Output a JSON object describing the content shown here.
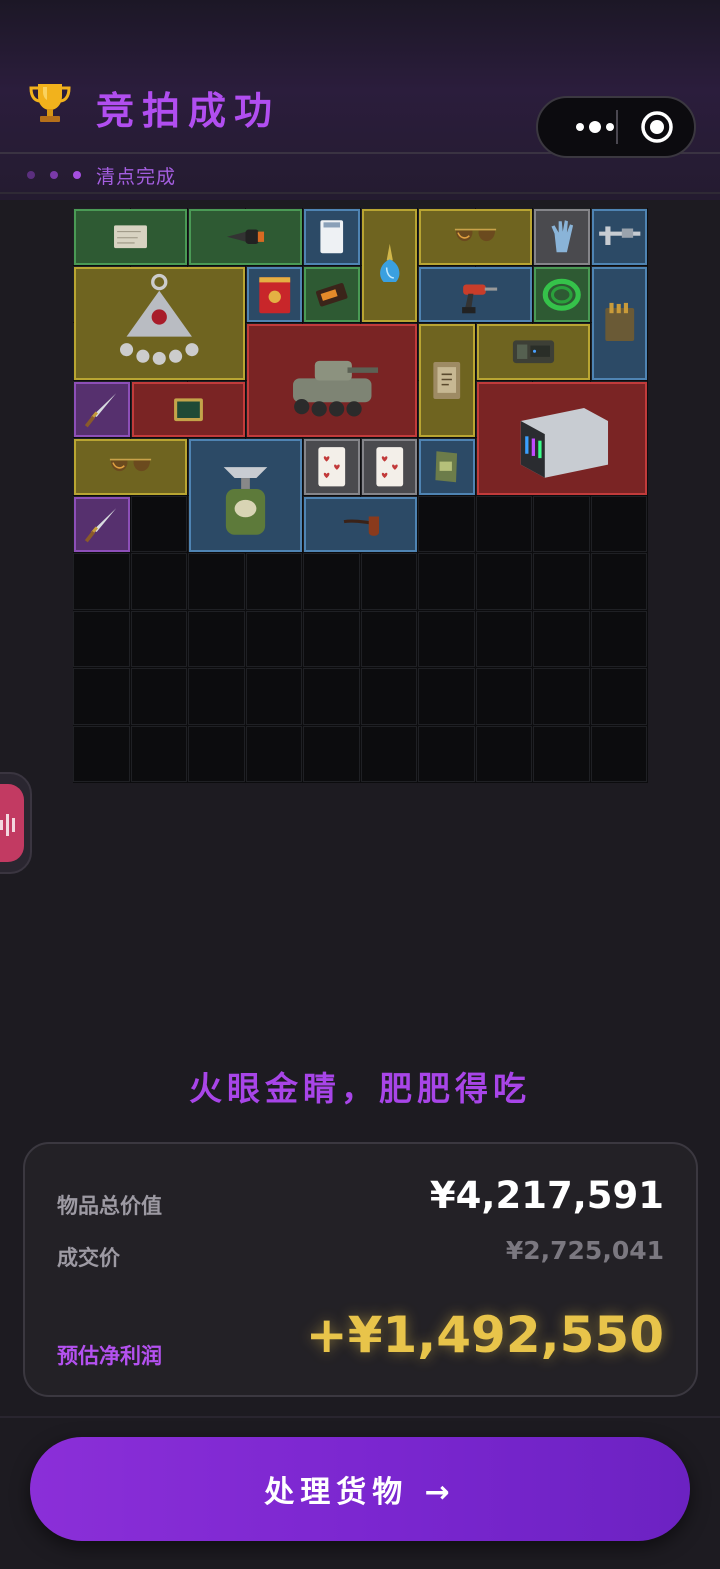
{
  "header": {
    "title": "竞拍成功",
    "trophy_icon": "trophy-icon"
  },
  "subbar": {
    "status_text": "清点完成",
    "dot_colors": [
      "#5b2f7e",
      "#7a3aa8",
      "#a54fe0"
    ]
  },
  "capsule": {
    "more_icon": "more-dots-icon",
    "close_icon": "target-circle-icon"
  },
  "inventory": {
    "columns": 10,
    "rows": 10,
    "items": [
      {
        "name": "map-scroll",
        "rarity": "green",
        "col": 0,
        "row": 0,
        "w": 2,
        "h": 1
      },
      {
        "name": "power-drill-bit",
        "rarity": "green",
        "col": 2,
        "row": 0,
        "w": 2,
        "h": 1
      },
      {
        "name": "memory-card",
        "rarity": "blue",
        "col": 4,
        "row": 0,
        "w": 1,
        "h": 1
      },
      {
        "name": "perfume-bottle",
        "rarity": "gold",
        "col": 5,
        "row": 0,
        "w": 1,
        "h": 2
      },
      {
        "name": "aviator-sunglasses",
        "rarity": "gold",
        "col": 6,
        "row": 0,
        "w": 2,
        "h": 1
      },
      {
        "name": "gloves",
        "rarity": "gray",
        "col": 8,
        "row": 0,
        "w": 1,
        "h": 1
      },
      {
        "name": "caliper",
        "rarity": "blue",
        "col": 9,
        "row": 0,
        "w": 1,
        "h": 1
      },
      {
        "name": "silver-pendant",
        "rarity": "gold",
        "col": 0,
        "row": 1,
        "w": 3,
        "h": 2
      },
      {
        "name": "tea-tin",
        "rarity": "blue",
        "col": 3,
        "row": 1,
        "w": 1,
        "h": 1
      },
      {
        "name": "candy-bar",
        "rarity": "green",
        "col": 4,
        "row": 1,
        "w": 1,
        "h": 1
      },
      {
        "name": "cordless-drill",
        "rarity": "blue",
        "col": 6,
        "row": 1,
        "w": 2,
        "h": 1
      },
      {
        "name": "wire-coil",
        "rarity": "green",
        "col": 8,
        "row": 1,
        "w": 1,
        "h": 1
      },
      {
        "name": "ammo-box",
        "rarity": "blue",
        "col": 9,
        "row": 1,
        "w": 1,
        "h": 2
      },
      {
        "name": "armored-vehicle",
        "rarity": "red",
        "col": 3,
        "row": 2,
        "w": 3,
        "h": 2
      },
      {
        "name": "old-book",
        "rarity": "gold",
        "col": 6,
        "row": 2,
        "w": 1,
        "h": 2
      },
      {
        "name": "circuit-device",
        "rarity": "gold",
        "col": 7,
        "row": 2,
        "w": 2,
        "h": 1
      },
      {
        "name": "dagger",
        "rarity": "purple",
        "col": 0,
        "row": 3,
        "w": 1,
        "h": 1
      },
      {
        "name": "jade-tablet",
        "rarity": "red",
        "col": 1,
        "row": 3,
        "w": 2,
        "h": 1
      },
      {
        "name": "nas-server",
        "rarity": "red",
        "col": 7,
        "row": 3,
        "w": 3,
        "h": 2
      },
      {
        "name": "aviator-sunglasses",
        "rarity": "gold",
        "col": 0,
        "row": 4,
        "w": 2,
        "h": 1
      },
      {
        "name": "camping-stove",
        "rarity": "blue",
        "col": 2,
        "row": 4,
        "w": 2,
        "h": 2
      },
      {
        "name": "playing-card",
        "rarity": "gray",
        "col": 4,
        "row": 4,
        "w": 1,
        "h": 1
      },
      {
        "name": "playing-card",
        "rarity": "gray",
        "col": 5,
        "row": 4,
        "w": 1,
        "h": 1
      },
      {
        "name": "snack-pack",
        "rarity": "blue",
        "col": 6,
        "row": 4,
        "w": 1,
        "h": 1
      },
      {
        "name": "dagger",
        "rarity": "purple",
        "col": 0,
        "row": 5,
        "w": 1,
        "h": 1
      },
      {
        "name": "tobacco-pipe",
        "rarity": "blue",
        "col": 4,
        "row": 5,
        "w": 2,
        "h": 1
      }
    ]
  },
  "slogan": "火眼金睛，肥肥得吃",
  "summary": {
    "total_value_label": "物品总价值",
    "total_value": "¥4,217,591",
    "deal_price_label": "成交价",
    "deal_price": "¥2,725,041",
    "profit_label": "预估净利润",
    "profit": "+¥1,492,550"
  },
  "cta": {
    "label": "处理货物 →"
  },
  "colors": {
    "accent_purple": "#a845e8",
    "profit_gold": "#e8c44a",
    "green": "#2e5a33",
    "blue": "#2c4a66",
    "gold": "#6f6420",
    "red": "#7a2424",
    "purple": "#56306e",
    "gray": "#4a4a4e"
  }
}
